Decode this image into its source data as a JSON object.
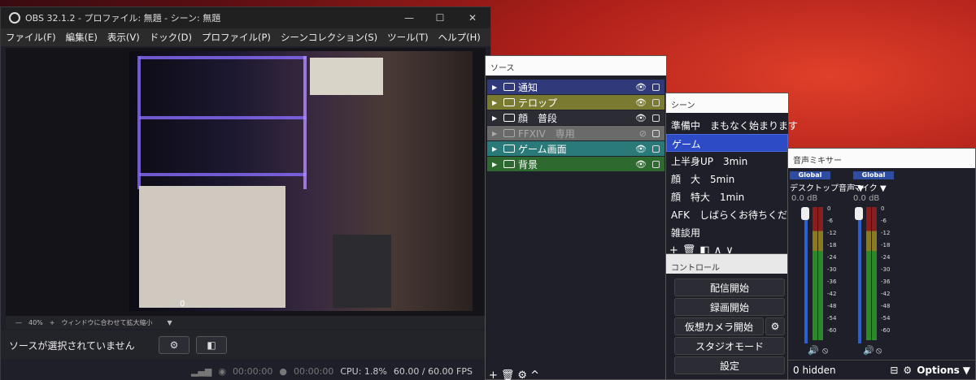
{
  "window": {
    "title": "OBS 32.1.2 - プロファイル: 無題 - シーン: 無題"
  },
  "menu": [
    "ファイル(F)",
    "編集(E)",
    "表示(V)",
    "ドック(D)",
    "プロファイル(P)",
    "シーンコレクション(S)",
    "ツール(T)",
    "ヘルプ(H)"
  ],
  "preview": {
    "zoom": "40%",
    "zoom_mode": "ウィンドウに合わせて拡大縮小",
    "overlay_count": "0"
  },
  "source_bar": {
    "no_source": "ソースが選択されていません"
  },
  "status": {
    "stream_time": "00:00:00",
    "rec_time": "00:00:00",
    "cpu": "CPU: 1.8%",
    "fps": "60.00 / 60.00 FPS"
  },
  "sources": {
    "title": "ソース",
    "items": [
      {
        "name": "通知",
        "color": "#303a7a",
        "hidden": false
      },
      {
        "name": "テロップ",
        "color": "#7a7a30",
        "hidden": false
      },
      {
        "name": "顔　普段",
        "color": "#2b2c34",
        "hidden": false
      },
      {
        "name": "FFXIV　専用",
        "color": "#6a6a6a",
        "hidden": true
      },
      {
        "name": "ゲーム画面",
        "color": "#2a7a7a",
        "hidden": false
      },
      {
        "name": "背景",
        "color": "#2e6a30",
        "hidden": false
      }
    ]
  },
  "scenes": {
    "title": "シーン",
    "items": [
      "準備中　まもなく始まります",
      "ゲーム",
      "上半身UP　3min",
      "顔　大　5min",
      "顔　特大　1min",
      "AFK　しばらくお待ちください",
      "雑談用"
    ],
    "selected": 1
  },
  "controls": {
    "title": "コントロール",
    "buttons": [
      "配信開始",
      "録画開始",
      "仮想カメラ開始",
      "スタジオモード",
      "設定"
    ]
  },
  "mixer": {
    "title": "音声ミキサー",
    "channels": [
      {
        "global": "Global",
        "name": "デスクトップ音声",
        "level": "0.0 dB"
      },
      {
        "global": "Global",
        "name": "マイク",
        "level": "0.0 dB"
      }
    ],
    "scale": [
      "0",
      "-6",
      "-12",
      "-18",
      "-24",
      "-30",
      "-36",
      "-42",
      "-48",
      "-54",
      "-60"
    ],
    "hidden": "0 hidden",
    "options": "Options"
  }
}
